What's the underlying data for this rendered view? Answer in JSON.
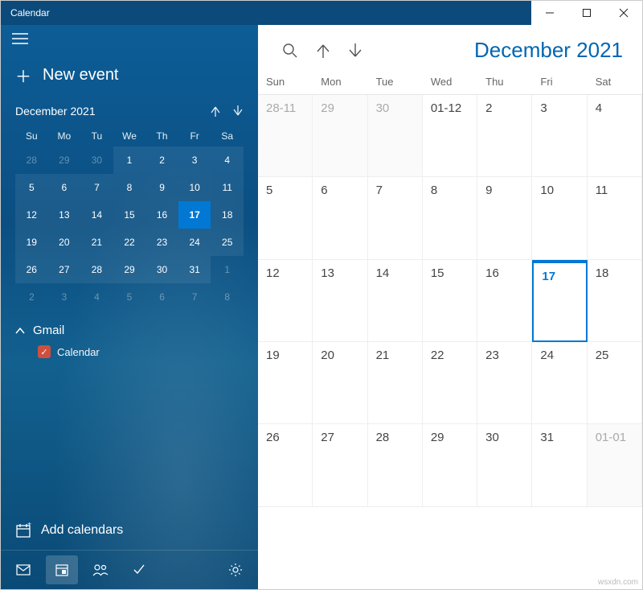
{
  "window": {
    "title": "Calendar"
  },
  "sidebar": {
    "new_event": "New event",
    "mini": {
      "label": "December 2021",
      "dow": [
        "Su",
        "Mo",
        "Tu",
        "We",
        "Th",
        "Fr",
        "Sa"
      ],
      "cells": [
        {
          "t": "28",
          "cls": "dim"
        },
        {
          "t": "29",
          "cls": "dim"
        },
        {
          "t": "30",
          "cls": "dim"
        },
        {
          "t": "1",
          "cls": "inrange"
        },
        {
          "t": "2",
          "cls": "inrange"
        },
        {
          "t": "3",
          "cls": "inrange"
        },
        {
          "t": "4",
          "cls": "inrange"
        },
        {
          "t": "5",
          "cls": "inrange"
        },
        {
          "t": "6",
          "cls": "inrange"
        },
        {
          "t": "7",
          "cls": "inrange"
        },
        {
          "t": "8",
          "cls": "inrange"
        },
        {
          "t": "9",
          "cls": "inrange"
        },
        {
          "t": "10",
          "cls": "inrange"
        },
        {
          "t": "11",
          "cls": "inrange"
        },
        {
          "t": "12",
          "cls": "inrange"
        },
        {
          "t": "13",
          "cls": "inrange"
        },
        {
          "t": "14",
          "cls": "inrange"
        },
        {
          "t": "15",
          "cls": "inrange"
        },
        {
          "t": "16",
          "cls": "inrange"
        },
        {
          "t": "17",
          "cls": "today"
        },
        {
          "t": "18",
          "cls": "inrange"
        },
        {
          "t": "19",
          "cls": "inrange"
        },
        {
          "t": "20",
          "cls": "inrange"
        },
        {
          "t": "21",
          "cls": "inrange"
        },
        {
          "t": "22",
          "cls": "inrange"
        },
        {
          "t": "23",
          "cls": "inrange"
        },
        {
          "t": "24",
          "cls": "inrange"
        },
        {
          "t": "25",
          "cls": "inrange"
        },
        {
          "t": "26",
          "cls": "inrange"
        },
        {
          "t": "27",
          "cls": "inrange"
        },
        {
          "t": "28",
          "cls": "inrange"
        },
        {
          "t": "29",
          "cls": "inrange"
        },
        {
          "t": "30",
          "cls": "inrange"
        },
        {
          "t": "31",
          "cls": "inrange"
        },
        {
          "t": "1",
          "cls": "dim"
        },
        {
          "t": "2",
          "cls": "dim"
        },
        {
          "t": "3",
          "cls": "dim"
        },
        {
          "t": "4",
          "cls": "dim"
        },
        {
          "t": "5",
          "cls": "dim"
        },
        {
          "t": "6",
          "cls": "dim"
        },
        {
          "t": "7",
          "cls": "dim"
        },
        {
          "t": "8",
          "cls": "dim"
        }
      ]
    },
    "account": {
      "name": "Gmail",
      "sub": "Calendar"
    },
    "add_calendars": "Add calendars"
  },
  "main": {
    "month_label": "December 2021",
    "dow": [
      "Sun",
      "Mon",
      "Tue",
      "Wed",
      "Thu",
      "Fri",
      "Sat"
    ],
    "cells": [
      {
        "t": "28-11",
        "cls": "dim"
      },
      {
        "t": "29",
        "cls": "dim"
      },
      {
        "t": "30",
        "cls": "dim"
      },
      {
        "t": "01-12",
        "cls": ""
      },
      {
        "t": "2",
        "cls": ""
      },
      {
        "t": "3",
        "cls": ""
      },
      {
        "t": "4",
        "cls": ""
      },
      {
        "t": "5",
        "cls": ""
      },
      {
        "t": "6",
        "cls": ""
      },
      {
        "t": "7",
        "cls": ""
      },
      {
        "t": "8",
        "cls": ""
      },
      {
        "t": "9",
        "cls": ""
      },
      {
        "t": "10",
        "cls": ""
      },
      {
        "t": "11",
        "cls": ""
      },
      {
        "t": "12",
        "cls": ""
      },
      {
        "t": "13",
        "cls": ""
      },
      {
        "t": "14",
        "cls": ""
      },
      {
        "t": "15",
        "cls": ""
      },
      {
        "t": "16",
        "cls": ""
      },
      {
        "t": "17",
        "cls": "today"
      },
      {
        "t": "18",
        "cls": ""
      },
      {
        "t": "19",
        "cls": ""
      },
      {
        "t": "20",
        "cls": ""
      },
      {
        "t": "21",
        "cls": ""
      },
      {
        "t": "22",
        "cls": ""
      },
      {
        "t": "23",
        "cls": ""
      },
      {
        "t": "24",
        "cls": ""
      },
      {
        "t": "25",
        "cls": ""
      },
      {
        "t": "26",
        "cls": ""
      },
      {
        "t": "27",
        "cls": ""
      },
      {
        "t": "28",
        "cls": ""
      },
      {
        "t": "29",
        "cls": ""
      },
      {
        "t": "30",
        "cls": ""
      },
      {
        "t": "31",
        "cls": ""
      },
      {
        "t": "01-01",
        "cls": "dim"
      }
    ]
  },
  "watermark": "wsxdn.com"
}
